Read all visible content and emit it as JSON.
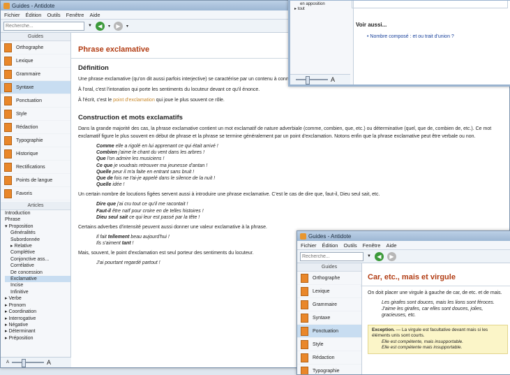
{
  "app": {
    "title": "Guides - Antidote"
  },
  "menu": [
    "Fichier",
    "Édition",
    "Outils",
    "Fenêtre",
    "Aide"
  ],
  "search": {
    "placeholder": "Recherche..."
  },
  "sidebar": {
    "guides_header": "Guides",
    "guides": [
      {
        "label": "Orthographe"
      },
      {
        "label": "Lexique"
      },
      {
        "label": "Grammaire"
      },
      {
        "label": "Syntaxe",
        "selected": true
      },
      {
        "label": "Ponctuation"
      },
      {
        "label": "Style"
      },
      {
        "label": "Rédaction"
      },
      {
        "label": "Typographie"
      },
      {
        "label": "Historique"
      },
      {
        "label": "Rectifications"
      },
      {
        "label": "Points de langue"
      },
      {
        "label": "Favoris"
      }
    ],
    "articles_header": "Articles",
    "tree": [
      {
        "label": "Introduction",
        "level": 1
      },
      {
        "label": "Phrase",
        "level": 1
      },
      {
        "label": "▾ Proposition",
        "level": 1
      },
      {
        "label": "Généralités",
        "level": 2
      },
      {
        "label": "Subordonnée",
        "level": 2
      },
      {
        "label": "▸ Relative",
        "level": 2
      },
      {
        "label": "Complétive",
        "level": 2
      },
      {
        "label": "Conjonctive ass...",
        "level": 2
      },
      {
        "label": "Corrélative",
        "level": 2
      },
      {
        "label": "De concession",
        "level": 2
      },
      {
        "label": "Exclamative",
        "level": 2,
        "selected": true
      },
      {
        "label": "Incise",
        "level": 2
      },
      {
        "label": "Infinitive",
        "level": 2
      },
      {
        "label": "▸ Verbe",
        "level": 1
      },
      {
        "label": "▸ Pronom",
        "level": 1
      },
      {
        "label": "▸ Coordination",
        "level": 1
      },
      {
        "label": "▸ Interrogative",
        "level": 1
      },
      {
        "label": "▸ Négative",
        "level": 1
      },
      {
        "label": "▸ Déterminant",
        "level": 1
      },
      {
        "label": "▸ Préposition",
        "level": 1
      }
    ]
  },
  "content": {
    "breadcrumb": "Syntaxe > Propo",
    "title": "Phrase exclamative",
    "sec1": "Définition",
    "p1": "Une phrase exclamative (qu'on dit aussi parfois interjective) se caractérise par un contenu à connotation affective. Elle exprime des émotions de surprise, de joie, de tristesse, etc.",
    "p2": "À l'oral, c'est l'intonation qui porte les sentiments du locuteur devant ce qu'il énonce.",
    "p3a": "À l'écrit, c'est le ",
    "p3link": "point d'exclamation",
    "p3b": " qui joue le plus souvent ce rôle.",
    "sec2": "Construction et mots exclamatifs",
    "p4": "Dans la grande majorité des cas, la phrase exclamative contient un mot exclamatif de nature adverbiale (comme, combien, que, etc.) ou déterminative (quel, que de, combien de, etc.). Ce mot exclamatif figure le plus souvent en début de phrase et la phrase se termine généralement par un point d'exclamation. Notons enfin que la phrase exclamative peut être verbale ou non.",
    "ex1": [
      {
        "w": "Comme",
        "t": " elle a rigolé en lui apprenant ce qui était arrivé !"
      },
      {
        "w": "Combien",
        "t": " j'aime le chant du vent dans les arbres !"
      },
      {
        "w": "Que",
        "t": " l'on admire les musiciens !"
      },
      {
        "w": "Ce que",
        "t": " je voudrais retrouver ma jeunesse d'antan !"
      },
      {
        "w": "Quelle",
        "t": " peur il m'a faite en entrant sans bruit !"
      },
      {
        "w": "Que de",
        "t": " fois ne t'ai-je appelé dans le silence de la nuit !"
      },
      {
        "w": "Quelle",
        "t": " idée !"
      }
    ],
    "p5": "Un certain nombre de locutions figées servent aussi à introduire une phrase exclamative. C'est le cas de dire que, faut-il, Dieu seul sait, etc.",
    "ex2": [
      {
        "w": "Dire que",
        "t": " j'ai cru tout ce qu'il me racontait !"
      },
      {
        "w": "Faut-il",
        "t": " être naïf pour croire en de telles histoires !"
      },
      {
        "w": "Dieu seul sait",
        "t": " ce qui leur est passé par la tête !"
      }
    ],
    "p6": "Certains adverbes d'intensité peuvent aussi donner une valeur exclamative à la phrase.",
    "ex3": [
      {
        "t1": "Il fait ",
        "w": "tellement",
        "t2": " beau aujourd'hui !"
      },
      {
        "t1": "Ils s'aiment ",
        "w": "tant",
        "t2": " !"
      }
    ],
    "p7": "Mais, souvent, le point d'exclamation est seul porteur des sentiments du locuteur.",
    "ex4": "J'ai pourtant regardé partout !"
  },
  "zoom_label": "A",
  "overlay1": {
    "tree_item1": "en apposition",
    "tree_item2": "▸ tout",
    "see_also": "Voir aussi...",
    "link": "Nombre composé : et ou trait d'union ?",
    "zoom_label": "A"
  },
  "overlay2": {
    "title": "Guides - Antidote",
    "menu": [
      "Fichier",
      "Édition",
      "Outils",
      "Fenêtre",
      "Aide"
    ],
    "search_placeholder": "Recherche...",
    "guides_header": "Guides",
    "guides": [
      "Orthographe",
      "Lexique",
      "Grammaire",
      "Syntaxe",
      "Ponctuation",
      "Style",
      "Rédaction",
      "Typographie"
    ],
    "selected_index": 4,
    "heading": "Car, etc., mais et virgule",
    "p1": "On doit placer une virgule à gauche de car, de etc. et de mais.",
    "ex1": "Les girafes sont douces, mais les lions sont féroces.",
    "ex2": "J'aime les girafes, car elles sont douces, jolies, gracieuses, etc.",
    "box_title": "Exception.",
    "box_t": " — La virgule est facultative devant mais si les éléments unis sont courts.",
    "box_ex1": "Elle est compétente, mais insupportable.",
    "box_ex2": "Elle est compétente mais insupportable."
  }
}
